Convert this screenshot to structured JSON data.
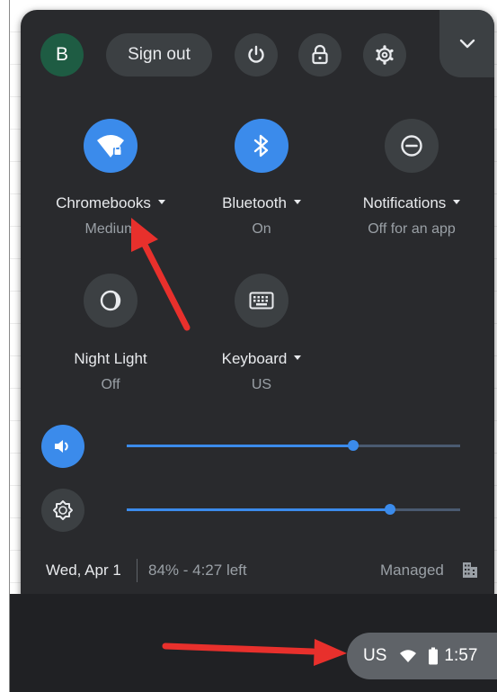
{
  "header": {
    "avatar_initial": "B",
    "sign_out_label": "Sign out",
    "icons": [
      "power-icon",
      "lock-icon",
      "settings-gear-icon",
      "chevron-down-icon"
    ]
  },
  "feature_pods": [
    {
      "label": "Chromebooks",
      "sublabel": "Medium",
      "icon": "wifi-locked-icon",
      "active": true,
      "has_menu": true
    },
    {
      "label": "Bluetooth",
      "sublabel": "On",
      "icon": "bluetooth-icon",
      "active": true,
      "has_menu": true
    },
    {
      "label": "Notifications",
      "sublabel": "Off for an app",
      "icon": "do-not-disturb-icon",
      "active": false,
      "has_menu": true
    },
    {
      "label": "Night Light",
      "sublabel": "Off",
      "icon": "night-light-icon",
      "active": false,
      "has_menu": false
    },
    {
      "label": "Keyboard",
      "sublabel": "US",
      "icon": "keyboard-icon",
      "active": false,
      "has_menu": true
    }
  ],
  "sliders": {
    "volume": {
      "icon": "volume-icon",
      "level": 0.68
    },
    "brightness": {
      "icon": "brightness-icon",
      "level": 0.79
    }
  },
  "footer": {
    "date": "Wed, Apr 1",
    "battery": "84% - 4:27 left",
    "managed": "Managed",
    "managed_icon": "enterprise-building-icon"
  },
  "shelf": {
    "language": "US",
    "time": "1:57",
    "icons": [
      "wifi-icon",
      "battery-icon"
    ]
  },
  "colors": {
    "panel_bg": "#292a2d",
    "button_bg": "#3c4043",
    "accent_blue": "#3b8beb",
    "avatar_green": "#1e5c43",
    "arrow_red": "#e8302c",
    "shelf_bg": "#202124"
  }
}
